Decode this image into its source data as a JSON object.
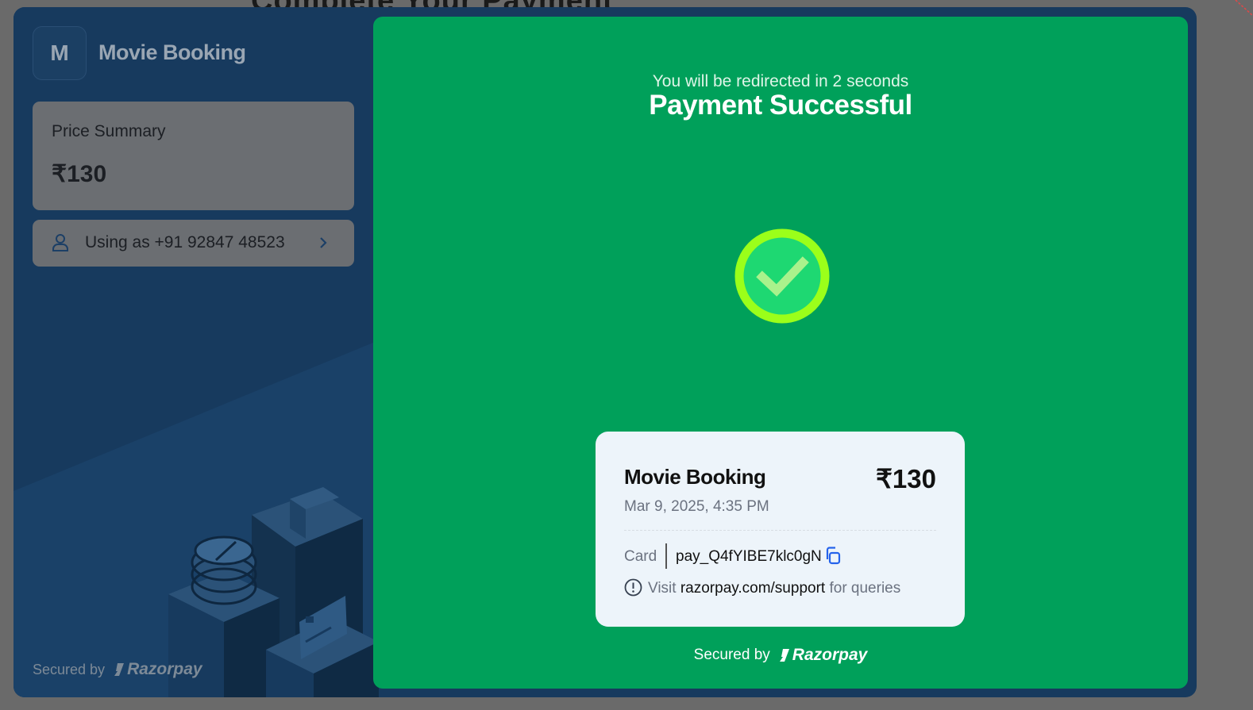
{
  "background": {
    "title": "Complete Your Payment"
  },
  "merchant": {
    "initial": "M",
    "name": "Movie Booking"
  },
  "price_summary": {
    "label": "Price Summary",
    "amount": "₹130"
  },
  "user": {
    "label": "Using as +91 92847 48523"
  },
  "left_footer": {
    "secured_by": "Secured by",
    "brand": "Razorpay"
  },
  "status": {
    "redirect_text": "You will be redirected in 2 seconds",
    "title": "Payment Successful"
  },
  "receipt": {
    "merchant": "Movie Booking",
    "amount": "₹130",
    "datetime": "Mar 9, 2025, 4:35 PM",
    "method": "Card",
    "payment_id": "pay_Q4fYIBE7klc0gN",
    "support_prefix": "Visit",
    "support_link": "razorpay.com/support",
    "support_suffix": "for queries"
  },
  "right_footer": {
    "secured_by": "Secured by",
    "brand": "Razorpay"
  },
  "colors": {
    "success_green": "#00a05a",
    "check_ring": "#9bff1a",
    "panel_blue": "#173a5e",
    "copy_icon_blue": "#2563eb"
  },
  "icons": [
    "user-icon",
    "chevron-right-icon",
    "success-check-icon",
    "copy-icon",
    "info-icon",
    "razorpay-logo-icon"
  ]
}
